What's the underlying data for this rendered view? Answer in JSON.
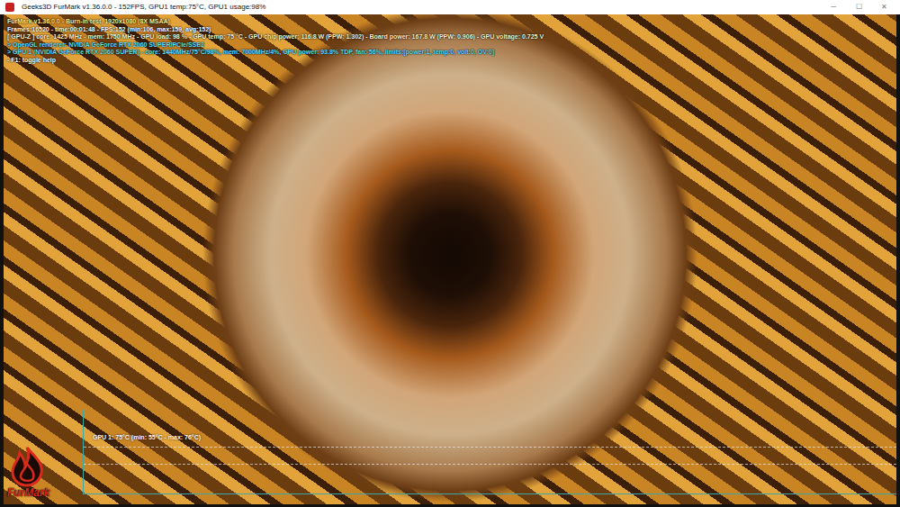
{
  "window": {
    "title": "Geeks3D FurMark v1.36.0.0 - 152FPS, GPU1 temp:75°C, GPU1 usage:98%",
    "controls": [
      "─",
      "☐",
      "✕"
    ]
  },
  "overlay": {
    "lines": [
      {
        "text": "FurMark v1.36.0.0 - Burn-in test, 1920x1080 (8X MSAA)",
        "color": "#ffee90"
      },
      {
        "text": "Frames:16520 - time:00:01:48 - FPS:152 (min:106, max:159, avg:152)",
        "color": "#ffffff"
      },
      {
        "text": "[ GPU-Z ] core: 1425 MHz - mem: 1750 MHz - GPU load: 98 % - GPU temp: 75 °C - GPU chip power: 116.8 W (PPW: 1.302) - Board power: 167.8 W (PPW: 0.906) - GPU voltage: 0.725 V",
        "color": "#fff6d0"
      },
      {
        "text": "> OpenGL renderer: NVIDIA GeForce RTX 2060 SUPER/PCIe/SSE2",
        "color": "#5fe0ff"
      },
      {
        "text": "> GPU 1 (NVIDIA GeForce RTX 2060 SUPER) - core: 1440MHz/75°C/98%, mem: 7000MHz/4%, GPU power: 93.8% TDP, fan: 56%, limits:[power:1, temp:0, volt:0, OV:0]",
        "color": "#5fe0ff"
      },
      {
        "text": "- F1: toggle help",
        "color": "#ffffff"
      }
    ]
  },
  "graph": {
    "label": "GPU 1: 75°C (min: 55°C - max: 76°C)"
  },
  "logo": {
    "text": "FurMark"
  }
}
